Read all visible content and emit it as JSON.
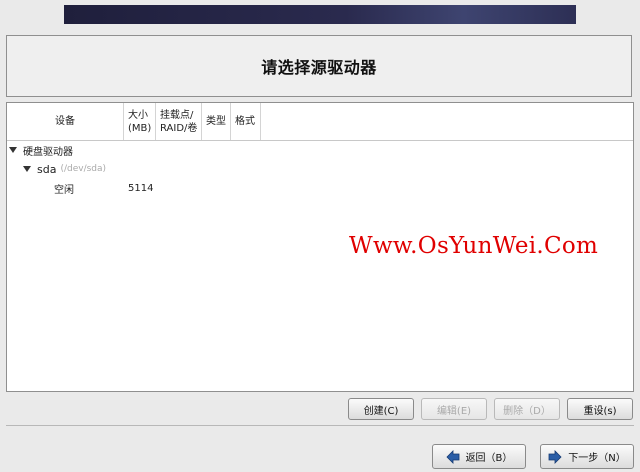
{
  "header": {
    "title": "请选择源驱动器"
  },
  "table": {
    "columns": {
      "device": "设备",
      "size": "大小\n(MB)",
      "mount": "挂载点/\nRAID/卷",
      "type": "类型",
      "format": "格式"
    },
    "rows": [
      {
        "label": "硬盘驱动器",
        "expanded": true
      },
      {
        "label": "sda",
        "sub": "(/dev/sda)",
        "expanded": true
      },
      {
        "label": "空闲",
        "size": "5114"
      }
    ]
  },
  "watermark": "Www.OsYunWei.Com",
  "buttons": {
    "create": "创建(C)",
    "edit": "编辑(E)",
    "delete": "删除（D）",
    "reset": "重设(s)"
  },
  "nav": {
    "back": "返回（B）",
    "next": "下一步（N）"
  },
  "colors": {
    "banner": "#1f1f3c",
    "watermark": "#e00000",
    "arrow": "#2b5ea7"
  }
}
